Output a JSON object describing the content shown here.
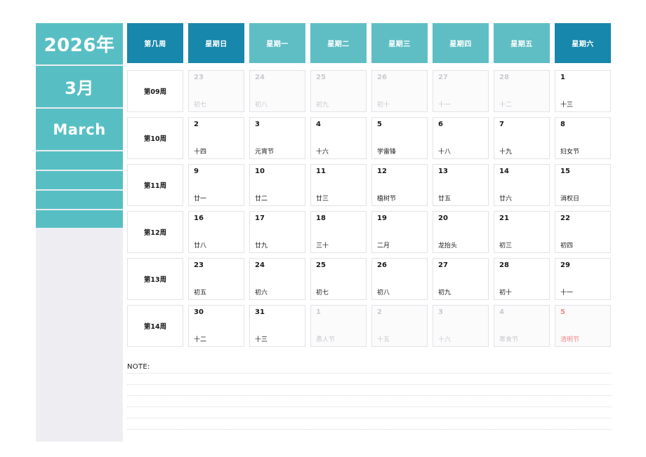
{
  "sidebar": {
    "year": "2026年",
    "month": "3月",
    "month_en": "March",
    "accent_dark": "#1787ab",
    "accent_light": "#5fbec4",
    "accent_sidebar": "#57bfc4",
    "panel_bg": "#eeeef2"
  },
  "header": {
    "columns": [
      {
        "label": "第几周",
        "tone": "dark"
      },
      {
        "label": "星期日",
        "tone": "dark"
      },
      {
        "label": "星期一",
        "tone": "light"
      },
      {
        "label": "星期二",
        "tone": "light"
      },
      {
        "label": "星期三",
        "tone": "light"
      },
      {
        "label": "星期四",
        "tone": "light"
      },
      {
        "label": "星期五",
        "tone": "light"
      },
      {
        "label": "星期六",
        "tone": "dark"
      }
    ]
  },
  "weeks": [
    {
      "week_label": "第09周",
      "days": [
        {
          "num": "23",
          "lunar": "初七",
          "outside": true,
          "red": false
        },
        {
          "num": "24",
          "lunar": "初八",
          "outside": true,
          "red": false
        },
        {
          "num": "25",
          "lunar": "初九",
          "outside": true,
          "red": false
        },
        {
          "num": "26",
          "lunar": "初十",
          "outside": true,
          "red": false
        },
        {
          "num": "27",
          "lunar": "十一",
          "outside": true,
          "red": false
        },
        {
          "num": "28",
          "lunar": "十二",
          "outside": true,
          "red": false
        },
        {
          "num": "1",
          "lunar": "十三",
          "outside": false,
          "red": false
        }
      ]
    },
    {
      "week_label": "第10周",
      "days": [
        {
          "num": "2",
          "lunar": "十四",
          "outside": false,
          "red": false
        },
        {
          "num": "3",
          "lunar": "元宵节",
          "outside": false,
          "red": false
        },
        {
          "num": "4",
          "lunar": "十六",
          "outside": false,
          "red": false
        },
        {
          "num": "5",
          "lunar": "学雷锋",
          "outside": false,
          "red": false
        },
        {
          "num": "6",
          "lunar": "十八",
          "outside": false,
          "red": false
        },
        {
          "num": "7",
          "lunar": "十九",
          "outside": false,
          "red": false
        },
        {
          "num": "8",
          "lunar": "妇女节",
          "outside": false,
          "red": false
        }
      ]
    },
    {
      "week_label": "第11周",
      "days": [
        {
          "num": "9",
          "lunar": "廿一",
          "outside": false,
          "red": false
        },
        {
          "num": "10",
          "lunar": "廿二",
          "outside": false,
          "red": false
        },
        {
          "num": "11",
          "lunar": "廿三",
          "outside": false,
          "red": false
        },
        {
          "num": "12",
          "lunar": "植树节",
          "outside": false,
          "red": false
        },
        {
          "num": "13",
          "lunar": "廿五",
          "outside": false,
          "red": false
        },
        {
          "num": "14",
          "lunar": "廿六",
          "outside": false,
          "red": false
        },
        {
          "num": "15",
          "lunar": "消权日",
          "outside": false,
          "red": false
        }
      ]
    },
    {
      "week_label": "第12周",
      "days": [
        {
          "num": "16",
          "lunar": "廿八",
          "outside": false,
          "red": false
        },
        {
          "num": "17",
          "lunar": "廿九",
          "outside": false,
          "red": false
        },
        {
          "num": "18",
          "lunar": "三十",
          "outside": false,
          "red": false
        },
        {
          "num": "19",
          "lunar": "二月",
          "outside": false,
          "red": false
        },
        {
          "num": "20",
          "lunar": "龙抬头",
          "outside": false,
          "red": false
        },
        {
          "num": "21",
          "lunar": "初三",
          "outside": false,
          "red": false
        },
        {
          "num": "22",
          "lunar": "初四",
          "outside": false,
          "red": false
        }
      ]
    },
    {
      "week_label": "第13周",
      "days": [
        {
          "num": "23",
          "lunar": "初五",
          "outside": false,
          "red": false
        },
        {
          "num": "24",
          "lunar": "初六",
          "outside": false,
          "red": false
        },
        {
          "num": "25",
          "lunar": "初七",
          "outside": false,
          "red": false
        },
        {
          "num": "26",
          "lunar": "初八",
          "outside": false,
          "red": false
        },
        {
          "num": "27",
          "lunar": "初九",
          "outside": false,
          "red": false
        },
        {
          "num": "28",
          "lunar": "初十",
          "outside": false,
          "red": false
        },
        {
          "num": "29",
          "lunar": "十一",
          "outside": false,
          "red": false
        }
      ]
    },
    {
      "week_label": "第14周",
      "days": [
        {
          "num": "30",
          "lunar": "十二",
          "outside": false,
          "red": false
        },
        {
          "num": "31",
          "lunar": "十三",
          "outside": false,
          "red": false
        },
        {
          "num": "1",
          "lunar": "愚人节",
          "outside": true,
          "red": false
        },
        {
          "num": "2",
          "lunar": "十五",
          "outside": true,
          "red": false
        },
        {
          "num": "3",
          "lunar": "十六",
          "outside": true,
          "red": false
        },
        {
          "num": "4",
          "lunar": "寒食节",
          "outside": true,
          "red": false
        },
        {
          "num": "5",
          "lunar": "清明节",
          "outside": true,
          "red": true
        }
      ]
    }
  ],
  "note": {
    "label": "NOTE:",
    "line_count": 6
  }
}
